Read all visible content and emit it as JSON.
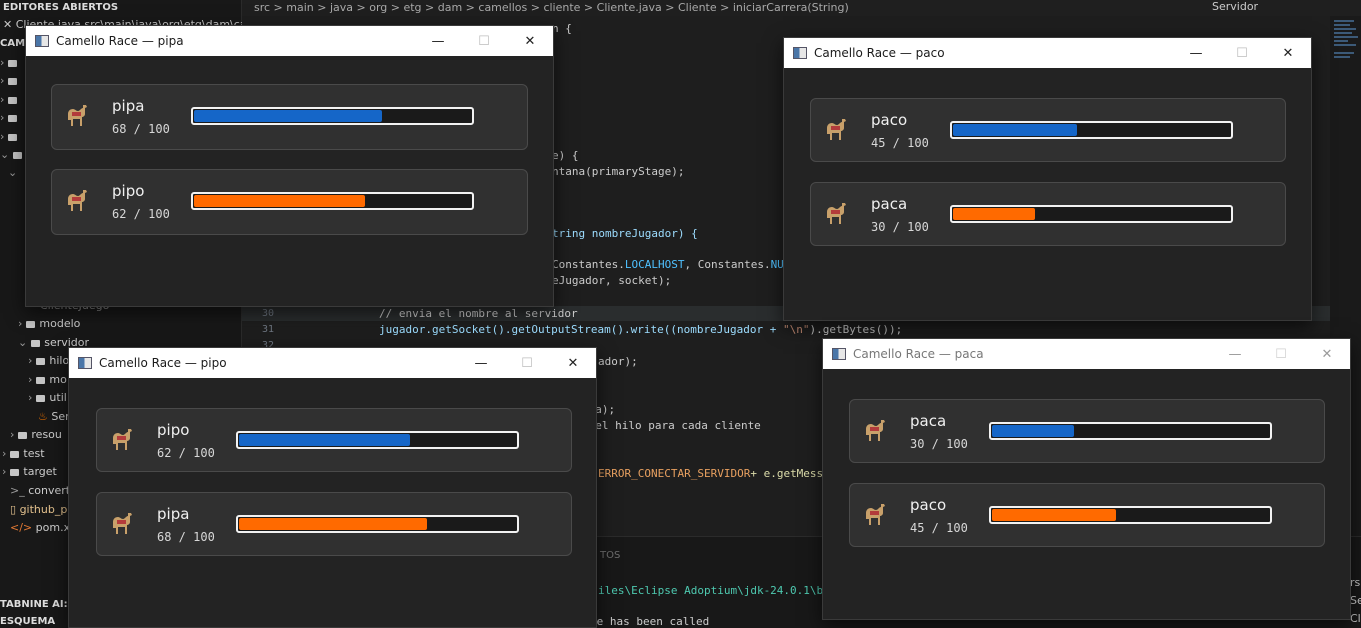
{
  "ide": {
    "breadcrumb": "src > main > java > org > etg > dam > camellos > cliente > Cliente.java > Cliente > iniciarCarrera(String)",
    "topright_label": "Servidor",
    "sidebar": {
      "open_editors_header": "EDITORES ABIERTOS",
      "open_file": "Cliente.java src\\main\\java\\org\\etg\\dam\\cam",
      "project_header": "CAMEL",
      "items": [
        "modelo",
        "servidor",
        "hilo",
        "mo",
        "util",
        "Ser",
        "resou",
        "test",
        "target",
        "convertir",
        "github_p",
        "pom.xml"
      ],
      "tabnine_header": "TABNINE AI: CHA",
      "outline_header": "ESQUEMA",
      "file_partial": "ClienteJuego"
    },
    "code": {
      "line_a": "n {",
      "line_b": "e) {",
      "line_c": "ntana(primaryStage);",
      "line_d": "tring nombreJugador) {",
      "line_e_start": "Constantes.",
      "line_e_const1": "LOCALHOST",
      "line_e_mid": ", Constantes.",
      "line_e_const2": "NUM",
      "line_f": "eJugador, socket);",
      "line_30_num": "30",
      "line_30": "// envia el nombre al servidor",
      "line_31_num": "31",
      "line_31_a": "jugador.getSocket().getOutputStream().write((nombreJugador + ",
      "line_31_str": "\"\\n\"",
      "line_31_b": ").getBytes());",
      "line_32_num": "32",
      "line_g": "ador);",
      "line_h": "sta);",
      "line_i": "a el hilo para cada cliente",
      "line_j_const": "ERROR_CONECTAR_SERVIDOR",
      "line_j_rest": "+ e.getMessa",
      "panel_label": "TOS",
      "terminal_1": "iles\\Eclipse Adoptium\\jdk-24.0.1\\bin\\",
      "terminal_2": "fe has been called",
      "right_1": "rs",
      "right_2": "Se",
      "right_3": "Cl"
    }
  },
  "windows": [
    {
      "id": "pipa",
      "title": "Camello Race — pipa",
      "players": [
        {
          "name": "pipa",
          "score": "68 / 100",
          "progress": 0.68,
          "bar": "blue"
        },
        {
          "name": "pipo",
          "score": "62 / 100",
          "progress": 0.62,
          "bar": "orange"
        }
      ]
    },
    {
      "id": "paco",
      "title": "Camello Race — paco",
      "players": [
        {
          "name": "paco",
          "score": "45 / 100",
          "progress": 0.45,
          "bar": "blue"
        },
        {
          "name": "paca",
          "score": "30 / 100",
          "progress": 0.3,
          "bar": "orange"
        }
      ]
    },
    {
      "id": "pipo",
      "title": "Camello Race — pipo",
      "players": [
        {
          "name": "pipo",
          "score": "62 / 100",
          "progress": 0.62,
          "bar": "blue"
        },
        {
          "name": "pipa",
          "score": "68 / 100",
          "progress": 0.68,
          "bar": "orange"
        }
      ]
    },
    {
      "id": "paca",
      "title": "Camello Race — paca",
      "players": [
        {
          "name": "paca",
          "score": "30 / 100",
          "progress": 0.3,
          "bar": "blue"
        },
        {
          "name": "paco",
          "score": "45 / 100",
          "progress": 0.45,
          "bar": "orange"
        }
      ]
    }
  ],
  "colors": {
    "bar_blue": "#1566c8",
    "bar_orange": "#ff6a00",
    "card_bg": "#303030",
    "window_bg": "#232323"
  },
  "icons": {
    "camel": "camel-emoji",
    "minimize": "minimize-icon",
    "maximize": "maximize-icon",
    "close": "close-icon"
  }
}
